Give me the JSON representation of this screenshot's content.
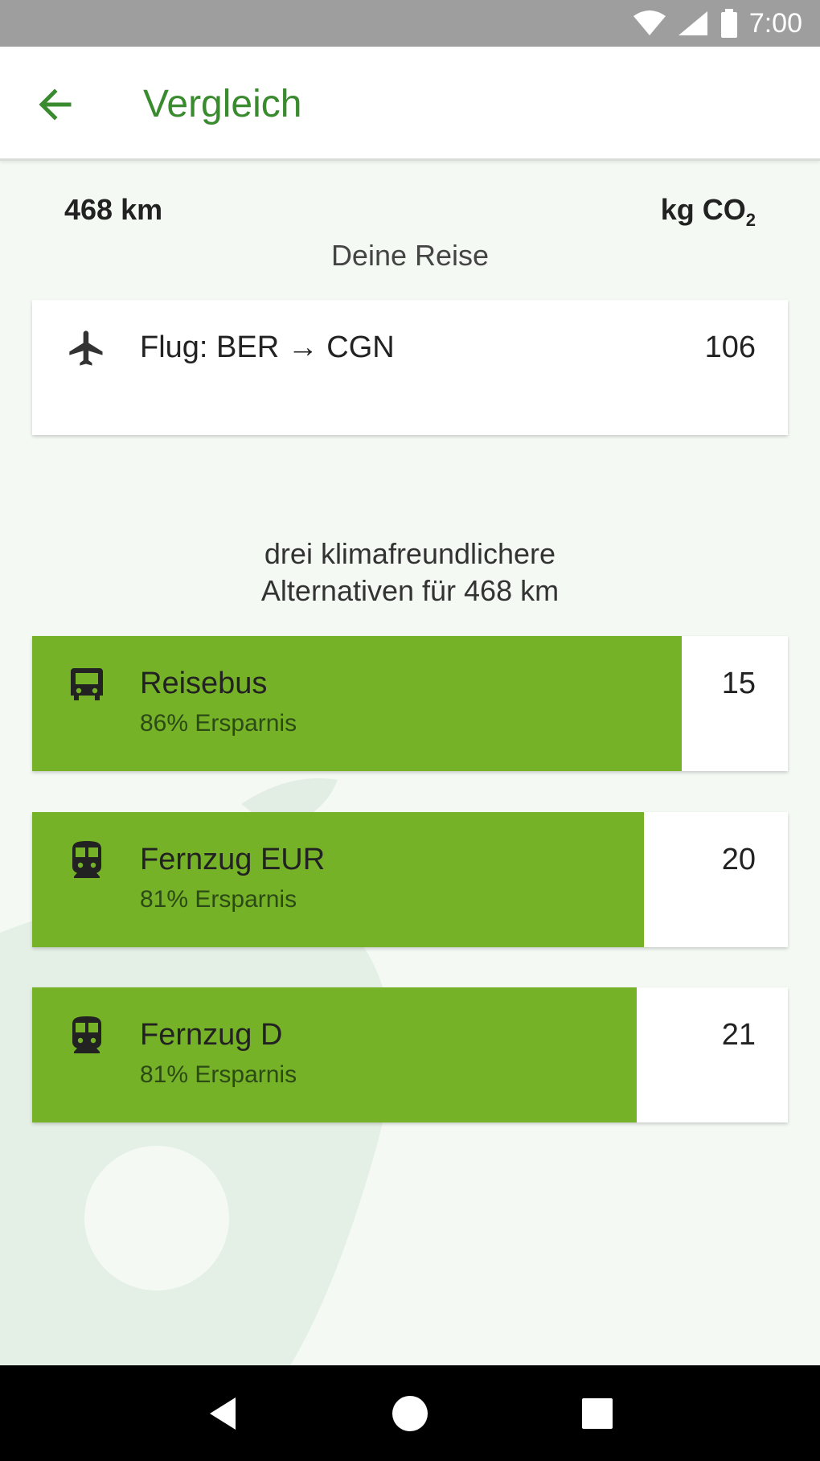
{
  "status_bar": {
    "time": "7:00"
  },
  "app_bar": {
    "title": "Vergleich"
  },
  "summary": {
    "distance": "468 km",
    "unit_main": "kg CO",
    "unit_sub": "2",
    "section_label": "Deine Reise"
  },
  "trip": {
    "icon": "airplane-icon",
    "label": "Flug: BER → CGN",
    "value": "106"
  },
  "alternatives_heading": {
    "line1": "drei klimafreundlichere",
    "line2": "Alternativen für 468 km"
  },
  "alternatives": [
    {
      "icon": "bus-icon",
      "name": "Reisebus",
      "saving": "86% Ersparnis",
      "value": "15",
      "fill_fraction": 0.86
    },
    {
      "icon": "train-icon",
      "name": "Fernzug EUR",
      "saving": "81% Ersparnis",
      "value": "20",
      "fill_fraction": 0.81
    },
    {
      "icon": "train-icon",
      "name": "Fernzug D",
      "saving": "81% Ersparnis",
      "value": "21",
      "fill_fraction": 0.8
    }
  ],
  "colors": {
    "accent_green": "#3a8a2f",
    "bar_green": "#76b227",
    "background": "#f4f9f4"
  }
}
